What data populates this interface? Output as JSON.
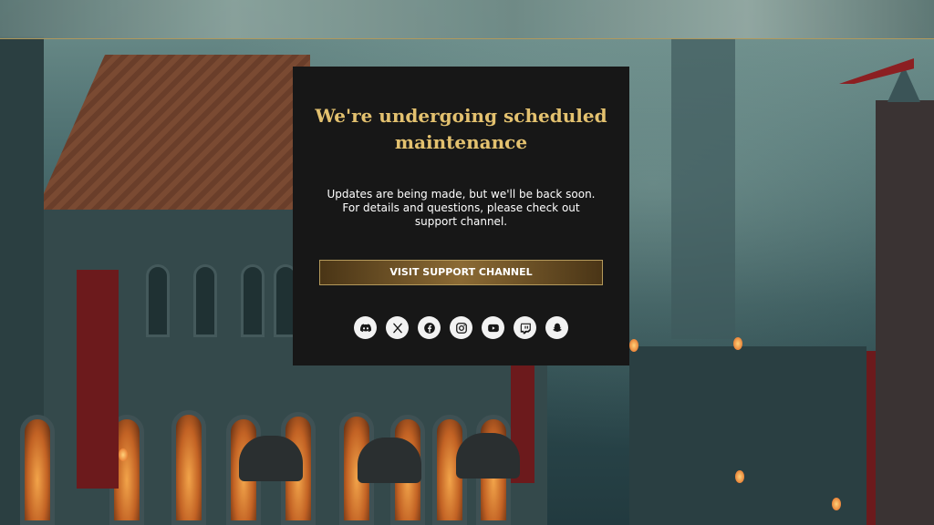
{
  "maintenance": {
    "title": "We're undergoing scheduled maintenance",
    "description": "Updates are being made, but we'll be back soon. For details and questions, please check out support channel.",
    "button_label": "VISIT SUPPORT CHANNEL",
    "accent_color": "#e3c16f"
  },
  "social_icons": [
    "discord-icon",
    "x-icon",
    "facebook-icon",
    "instagram-icon",
    "youtube-icon",
    "twitch-icon",
    "snapchat-icon"
  ]
}
